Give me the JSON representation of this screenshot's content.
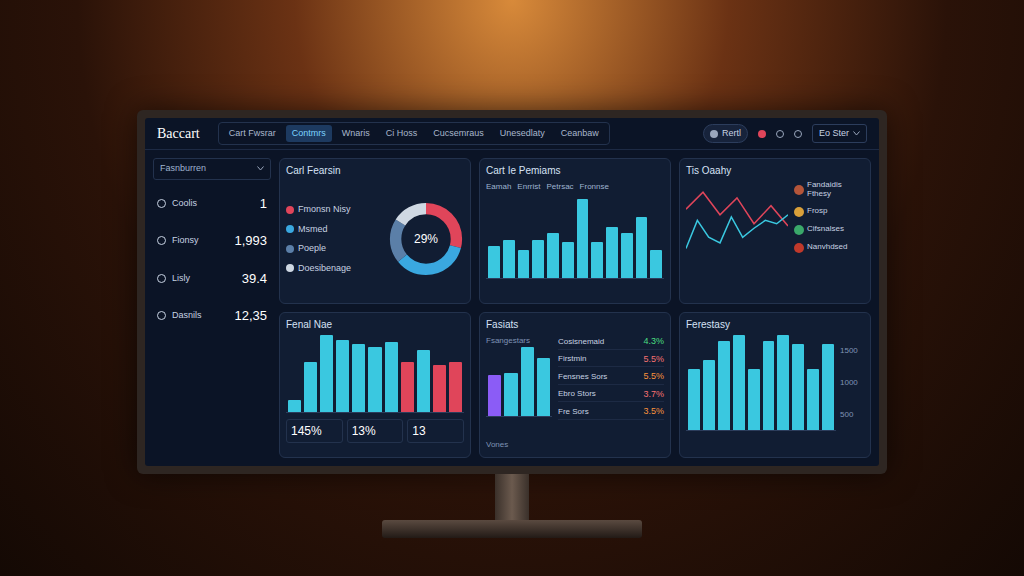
{
  "title": "Baccart",
  "tabs": [
    {
      "label": "Cart Fwsrar",
      "selected": false
    },
    {
      "label": "Contmrs",
      "selected": true
    },
    {
      "label": "Wnaris",
      "selected": false
    },
    {
      "label": "Ci Hoss",
      "selected": false
    },
    {
      "label": "Cucsemraus",
      "selected": false
    },
    {
      "label": "Unesedlaty",
      "selected": false
    },
    {
      "label": "Ceanbaw",
      "selected": false
    }
  ],
  "search": "Rertl",
  "dropdown": "Eo Ster",
  "sidebar": {
    "header": "Fasnburren",
    "items": [
      {
        "label": "Coolis",
        "value": "1"
      },
      {
        "label": "Fionsy",
        "value": "1,993"
      },
      {
        "label": "Lisly",
        "value": "39.4"
      },
      {
        "label": "Dasnils",
        "value": "12,35"
      }
    ]
  },
  "donut_card": {
    "title": "Carl Fearsin",
    "center": "29%",
    "segments": [
      {
        "label": "Fmonsn Nisy",
        "value": 29,
        "color": "#e0455a"
      },
      {
        "label": "Msmed",
        "value": 35,
        "color": "#3aa8e0"
      },
      {
        "label": "Poeple",
        "value": 20,
        "color": "#5b7fa8"
      },
      {
        "label": "Doesibenage",
        "value": 16,
        "color": "#cfd8e3"
      }
    ]
  },
  "bar_card": {
    "title": "Cart Ie Pemiams",
    "legend": [
      "Eamah",
      "Enrrist",
      "Petrsac",
      "Fronnse"
    ],
    "values": [
      25,
      30,
      22,
      30,
      35,
      28,
      62,
      28,
      40,
      35,
      48,
      22
    ]
  },
  "line_card": {
    "title": "Tis Oaahy",
    "series": [
      {
        "color": "#e0455a",
        "values": [
          55,
          70,
          50,
          65,
          42,
          58,
          40
        ]
      },
      {
        "color": "#3ac8e0",
        "values": [
          20,
          45,
          30,
          25,
          48,
          30,
          38,
          45,
          42,
          50
        ]
      }
    ],
    "people": [
      {
        "name": "Fandaidis Fthesy",
        "color": "#b4553a"
      },
      {
        "name": "Frosp",
        "color": "#d9a03a"
      },
      {
        "name": "Cifsnalses",
        "color": "#3aa86a"
      },
      {
        "name": "Nanvhdsed",
        "color": "#c0392b"
      }
    ]
  },
  "bottom_bar_card": {
    "title": "Fenal Nae",
    "bars": [
      {
        "value": 10,
        "color": "#3ac8e0"
      },
      {
        "value": 40,
        "color": "#3ac8e0"
      },
      {
        "value": 62,
        "color": "#3ac8e0"
      },
      {
        "value": 58,
        "color": "#3ac8e0"
      },
      {
        "value": 55,
        "color": "#3ac8e0"
      },
      {
        "value": 52,
        "color": "#3ac8e0"
      },
      {
        "value": 56,
        "color": "#3ac8e0"
      },
      {
        "value": 40,
        "color": "#e0455a"
      },
      {
        "value": 50,
        "color": "#3ac8e0"
      },
      {
        "value": 38,
        "color": "#e0455a"
      },
      {
        "value": 40,
        "color": "#e0455a"
      }
    ],
    "stats": [
      "145%",
      "13%",
      "13"
    ]
  },
  "stats_card": {
    "title": "Fasiats",
    "axis_label": "Fsangestars",
    "bars": [
      {
        "value": 38,
        "color": "#8b5cf6"
      },
      {
        "value": 40,
        "color": "#3ac8e0"
      },
      {
        "value": 64,
        "color": "#3ac8e0"
      },
      {
        "value": 54,
        "color": "#3ac8e0"
      }
    ],
    "rows": [
      {
        "label": "Cosisnemaid",
        "value": "4.3%",
        "color": "#4ade80"
      },
      {
        "label": "Firstmin",
        "value": "5.5%",
        "color": "#f87171"
      },
      {
        "label": "Fensnes Sors",
        "value": "5.5%",
        "color": "#fb923c"
      },
      {
        "label": "Ebro Stors",
        "value": "3.7%",
        "color": "#f87171"
      },
      {
        "label": "Fre Sors",
        "value": "3.5%",
        "color": "#fb923c"
      }
    ],
    "footer": "Vones"
  },
  "right_card": {
    "title": "Ferestasy",
    "ticks": [
      "1500",
      "1000",
      "500"
    ],
    "values": [
      40,
      46,
      58,
      62,
      40,
      58,
      62,
      56,
      40,
      56
    ]
  }
}
